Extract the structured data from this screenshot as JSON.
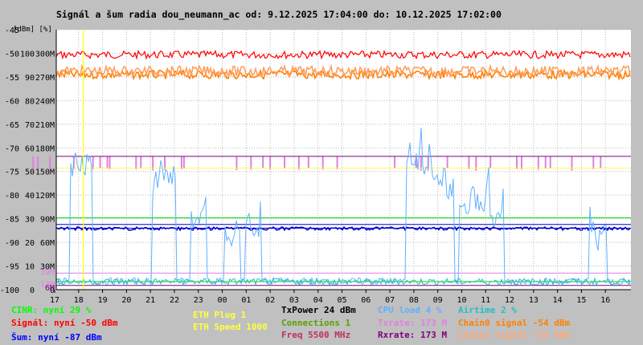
{
  "title": "Signál a šum radia dou_neumann_ac od: 9.12.2025 17:04:00 do: 10.12.2025 17:02:00",
  "colors": {
    "background": "#c0c0c0",
    "plot": "#ffffff",
    "grid": "#b8b8b8",
    "signal": "#ff0000",
    "chain0": "#ff8000",
    "chain1": "#ffa060",
    "noise": "#0000cc",
    "cinr": "#00dd00",
    "cpu": "#60b0ff",
    "airtime": "#20c0c0",
    "txrate": "#e080e0",
    "rxrate": "#800080",
    "eth": "#ffff40",
    "marker": "#ffff00"
  },
  "chart_data": {
    "type": "line",
    "title": "Signál a šum radia dou_neumann_ac od: 9.12.2025 17:04:00 do: 10.12.2025 17:02:00",
    "xlabel": "[h]",
    "x_ticks": [
      "18",
      "19",
      "20",
      "21",
      "22",
      "23",
      "00",
      "01",
      "02",
      "03",
      "04",
      "05",
      "06",
      "07",
      "08",
      "09",
      "10",
      "11",
      "12",
      "13",
      "14",
      "15",
      "16",
      "17"
    ],
    "y_header": "[dBm] [%]",
    "y_ticks_dbm": [
      "-45",
      "-50",
      "-55",
      "-60",
      "-65",
      "-70",
      "-75",
      "-80",
      "-85",
      "-90",
      "-95",
      "-100"
    ],
    "y_ticks_pct": [
      "",
      "100",
      "90",
      "80",
      "70",
      "60",
      "50",
      "40",
      "30",
      "20",
      "10",
      "0"
    ],
    "y_ticks_rate": [
      "",
      "300M",
      "270M",
      "240M",
      "210M",
      "180M",
      "150M",
      "120M",
      "90M",
      "60M",
      "30M",
      "0"
    ],
    "y_ticks_rate_left_colored": [
      {
        "text": "39M",
        "color": "#e080e0",
        "dbm": -96.2
      },
      {
        "text": "13M",
        "color": "#e080e0",
        "dbm": -98.7
      },
      {
        "text": "6M",
        "color": "#800080",
        "dbm": -99.5
      }
    ],
    "ylim": [
      -100,
      -45
    ],
    "marker_x": 18.2,
    "series": [
      {
        "name": "Signál",
        "type": "band",
        "color": "#ff0000",
        "center": -50.3,
        "spread": 0.8,
        "style": "sparse-ticks"
      },
      {
        "name": "Chain0 signal",
        "type": "band",
        "color": "#ff8000",
        "center": -54.5,
        "spread": 0.9,
        "style": "dense"
      },
      {
        "name": "Chain1 signal",
        "type": "band",
        "color": "#ffa060",
        "center": -53.8,
        "spread": 1.1,
        "style": "dense"
      },
      {
        "name": "Šum",
        "type": "flat",
        "color": "#0000cc",
        "value": -87,
        "extra_line": -86.2,
        "dip": -88
      },
      {
        "name": "Rxrate",
        "type": "flat",
        "color": "#800080",
        "value": -71.8,
        "extra_line": -99.1
      },
      {
        "name": "ETH",
        "type": "flat",
        "color": "#ffff40",
        "value": -74.3,
        "extra_line": -98.3
      },
      {
        "name": "CINR",
        "type": "flat",
        "color": "#00dd00",
        "value": -84.8,
        "extra_line": -98.3
      },
      {
        "name": "Txrate",
        "type": "flat",
        "color": "#e080e0",
        "value": -96.5
      },
      {
        "name": "CPU load",
        "type": "noise",
        "color": "#60b0ff",
        "base": -99,
        "spikes": [
          [
            18.0,
            -78
          ],
          [
            18.2,
            -79
          ],
          [
            21.4,
            -82
          ],
          [
            21.7,
            -80
          ],
          [
            23.0,
            -88
          ],
          [
            0.4,
            -92
          ],
          [
            1.3,
            -90
          ],
          [
            8.0,
            -76
          ],
          [
            8.4,
            -78
          ],
          [
            9.0,
            -81
          ],
          [
            9.3,
            -84
          ],
          [
            10.2,
            -86
          ],
          [
            10.8,
            -85
          ],
          [
            11.4,
            -88
          ],
          [
            15.7,
            -92
          ]
        ]
      }
    ],
    "eth_ticks": [
      17.8,
      18.6,
      18.9,
      19.2,
      19.3,
      20.4,
      20.6,
      21.1,
      21.6,
      22.3,
      22.4,
      0.6,
      1.2,
      1.7,
      2.0,
      2.6,
      3.2,
      3.6,
      4.2,
      4.8,
      7.2,
      8.1,
      8.3,
      8.6,
      9.4,
      10.3,
      10.6,
      11.2,
      12.3,
      12.5,
      13.2,
      13.5,
      13.7,
      14.6,
      15.5,
      15.8,
      16.1,
      16.3,
      16.8
    ]
  },
  "legend": {
    "cinr": "CINR: nyní 29 %",
    "signal": "Signál: nyní -50 dBm",
    "noise": "Šum: nyní -87 dBm",
    "eth_plug": "ETH Plug 1",
    "eth_speed": "ETH Speed 1000",
    "txpower": "TxPower 24 dBm",
    "connections": "Connections 1",
    "freq": "Freq 5500 MHz",
    "cpu": "CPU load 4 %",
    "txrate": "Txrate: 173 M",
    "rxrate": "Rxrate: 173 M",
    "airtime": "Airtime 2 %",
    "chain0": "Chain0 signal -54 dBm",
    "chain1": "Chain1 signal -53 dBm"
  },
  "legend_colors": {
    "cinr": "#00ff00",
    "signal": "#ff0000",
    "noise": "#0000ff",
    "eth_plug": "#ffff40",
    "eth_speed": "#ffff40",
    "txpower": "#000000",
    "connections": "#5aa000",
    "freq": "#c03060",
    "cpu": "#60b0ff",
    "txrate": "#e080e0",
    "rxrate": "#800080",
    "airtime": "#20c0c0",
    "chain0": "#ff8000",
    "chain1": "#ffa878"
  }
}
